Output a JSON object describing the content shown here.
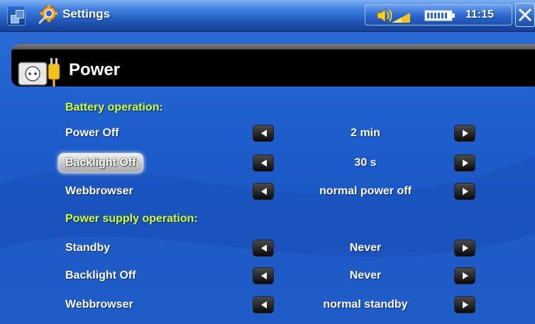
{
  "topbar": {
    "app_icon": "settings-gear-icon",
    "title": "Settings",
    "clock": "11:15",
    "menu_icon": "windows-menu-icon",
    "volume_icon": "speaker-volume-icon",
    "battery_icon": "battery-icon",
    "close_icon": "close-icon"
  },
  "header": {
    "icon": "power-outlet-icon",
    "title": "Power"
  },
  "sections": {
    "battery": "Battery operation:",
    "supply": "Power supply operation:"
  },
  "rows": [
    {
      "label": "Power Off",
      "value": "2 min",
      "selected": false
    },
    {
      "label": "Backlight Off",
      "value": "30 s",
      "selected": true
    },
    {
      "label": "Webbrowser",
      "value": "normal power off",
      "selected": false
    },
    {
      "label": "Standby",
      "value": "Never",
      "selected": false
    },
    {
      "label": "Backlight Off",
      "value": "Never",
      "selected": false
    },
    {
      "label": "Webbrowser",
      "value": "normal standby",
      "selected": false
    }
  ],
  "colors": {
    "section_text": "#d4ff2a",
    "background": "#1e5fce",
    "header_bar": "#000000"
  }
}
